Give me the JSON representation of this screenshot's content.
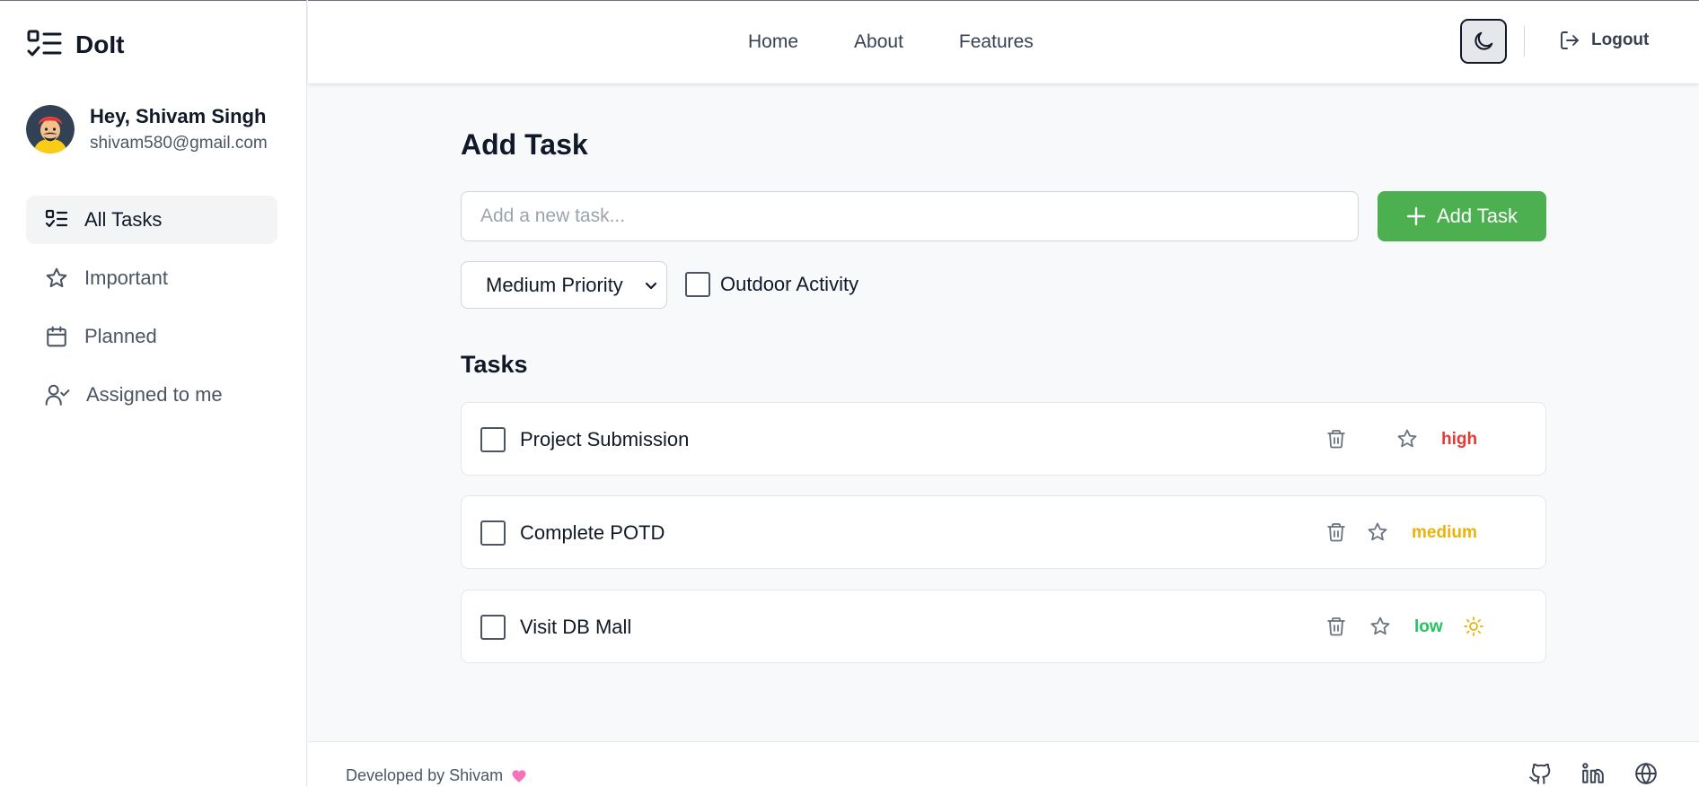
{
  "brand": {
    "title": "DoIt"
  },
  "user": {
    "greeting": "Hey, Shivam Singh",
    "email": "shivam580@gmail.com"
  },
  "sidebar": {
    "items": [
      {
        "label": "All Tasks",
        "icon": "list-check-icon",
        "active": true
      },
      {
        "label": "Important",
        "icon": "star-icon"
      },
      {
        "label": "Planned",
        "icon": "calendar-icon"
      },
      {
        "label": "Assigned to me",
        "icon": "user-check-icon"
      }
    ]
  },
  "header": {
    "nav": [
      "Home",
      "About",
      "Features"
    ],
    "theme_toggle_icon": "moon-icon",
    "logout_label": "Logout"
  },
  "main": {
    "title": "Add Task",
    "input_placeholder": "Add a new task...",
    "add_button_label": "Add Task",
    "priority_selected": "Medium Priority",
    "outdoor_label": "Outdoor Activity",
    "tasks_title": "Tasks"
  },
  "tasks": [
    {
      "text": "Project Submission",
      "priority": "high",
      "priority_color": "#e53935",
      "outdoor": false
    },
    {
      "text": "Complete POTD",
      "priority": "medium",
      "priority_color": "#eab308",
      "outdoor": false
    },
    {
      "text": "Visit DB Mall",
      "priority": "low",
      "priority_color": "#22c55e",
      "outdoor": true
    }
  ],
  "footer": {
    "credit": "Developed by Shivam",
    "links": [
      "github-icon",
      "linkedin-icon",
      "globe-icon"
    ]
  },
  "colors": {
    "accent": "#4caf50",
    "heart": "#f472b6",
    "sun": "#eab308"
  }
}
